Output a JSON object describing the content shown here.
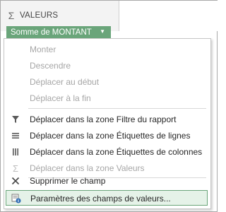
{
  "panel": {
    "section_title": "VALEURS",
    "field_label": "Somme de MONTANT"
  },
  "menu": {
    "items": [
      {
        "label": "Monter",
        "enabled": false,
        "icon": "none"
      },
      {
        "label": "Descendre",
        "enabled": false,
        "icon": "none"
      },
      {
        "label": "Déplacer au début",
        "enabled": false,
        "icon": "none"
      },
      {
        "label": "Déplacer à la fin",
        "enabled": false,
        "icon": "none"
      },
      {
        "label": "Déplacer dans la zone Filtre du rapport",
        "enabled": true,
        "icon": "filter-icon"
      },
      {
        "label": "Déplacer dans la zone Étiquettes de lignes",
        "enabled": true,
        "icon": "rows-icon"
      },
      {
        "label": "Déplacer dans la zone Étiquettes de colonnes",
        "enabled": true,
        "icon": "columns-icon"
      },
      {
        "label": "Déplacer dans la zone Valeurs",
        "enabled": false,
        "icon": "sigma-icon"
      },
      {
        "label": "Supprimer le champ",
        "enabled": true,
        "icon": "remove-x-icon"
      },
      {
        "label": "Paramètres des champs de valeurs...",
        "enabled": true,
        "icon": "field-settings-icon",
        "highlighted": true
      }
    ]
  },
  "colors": {
    "accent": "#6aa57a",
    "highlight_bg": "#e5f2e8",
    "disabled_text": "#a6a6a6"
  }
}
